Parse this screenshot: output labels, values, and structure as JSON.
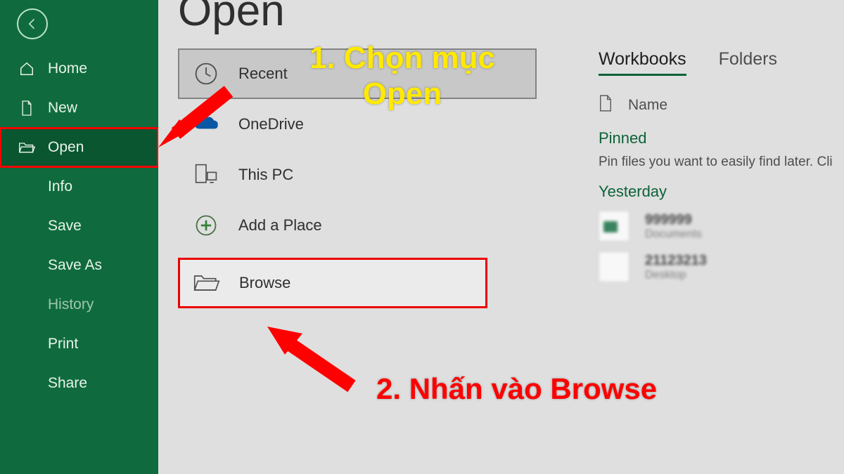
{
  "page_title": "Open",
  "sidebar": {
    "items": [
      {
        "label": "Home",
        "icon": "home-icon"
      },
      {
        "label": "New",
        "icon": "new-doc-icon"
      },
      {
        "label": "Open",
        "icon": "folder-open-icon",
        "selected": true
      },
      {
        "label": "Info"
      },
      {
        "label": "Save"
      },
      {
        "label": "Save As"
      },
      {
        "label": "History",
        "dim": true
      },
      {
        "label": "Print"
      },
      {
        "label": "Share"
      }
    ]
  },
  "locations": {
    "recent": "Recent",
    "onedrive": "OneDrive",
    "thispc": "This PC",
    "addplace": "Add a Place",
    "browse": "Browse"
  },
  "right": {
    "tabs": {
      "workbooks": "Workbooks",
      "folders": "Folders"
    },
    "col_name": "Name",
    "pinned_header": "Pinned",
    "pin_hint": "Pin files you want to easily find later. Cli",
    "yesterday": "Yesterday"
  },
  "annotations": {
    "step1": "1. Chọn mục\nOpen",
    "step2": "2. Nhấn vào Browse"
  }
}
